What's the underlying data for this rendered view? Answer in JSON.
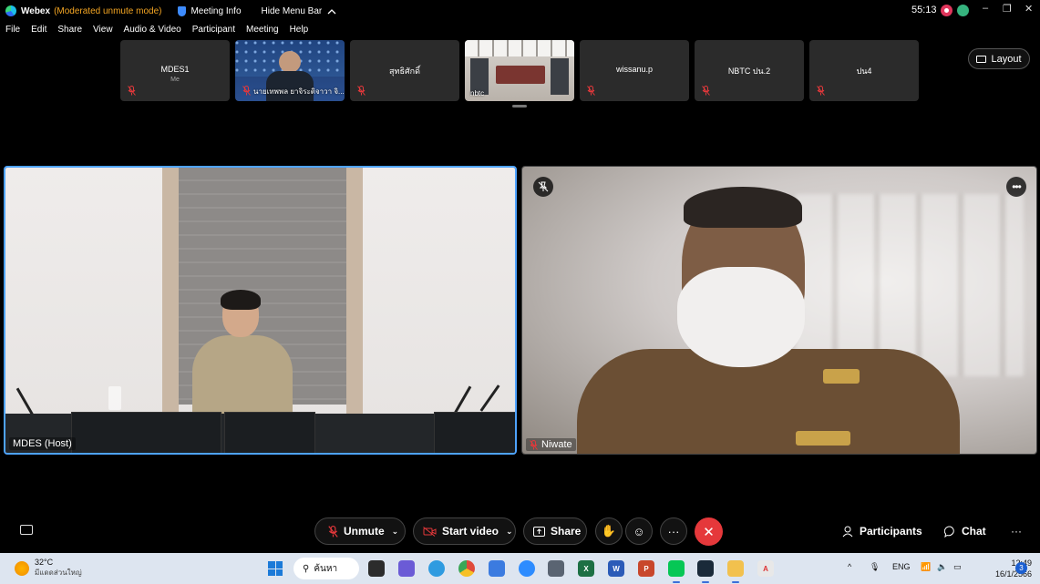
{
  "titlebar": {
    "app_name": "Webex",
    "mode": "(Moderated unmute mode)",
    "meeting_info": "Meeting Info",
    "hide_menu": "Hide Menu Bar",
    "hide_menu_icon": "chevron-up-icon",
    "timer": "55:13",
    "window_controls": [
      "–",
      "❐",
      "✕"
    ]
  },
  "menu": [
    "File",
    "Edit",
    "Share",
    "View",
    "Audio & Video",
    "Participant",
    "Meeting",
    "Help"
  ],
  "thumbnails": [
    {
      "name": "MDES1",
      "sub": "Me",
      "type": "placeholder",
      "muted": true
    },
    {
      "name": "นายเทพพล ยาจิระติจาวา จิ...",
      "sub": "",
      "type": "video",
      "muted": true
    },
    {
      "name": "สุทธิศักดิ์",
      "sub": "",
      "type": "placeholder",
      "muted": true
    },
    {
      "name": "nbtc",
      "sub": "",
      "type": "video",
      "muted": false
    },
    {
      "name": "wissanu.p",
      "sub": "",
      "type": "placeholder",
      "muted": true
    },
    {
      "name": "NBTC ปน.2",
      "sub": "",
      "type": "placeholder",
      "muted": true
    },
    {
      "name": "ปน4",
      "sub": "",
      "type": "placeholder",
      "muted": true
    }
  ],
  "layout_button": "Layout",
  "main_videos": [
    {
      "name": "MDES (Host)",
      "active_speaker": true,
      "muted": false
    },
    {
      "name": "Niwate",
      "active_speaker": false,
      "muted": true
    }
  ],
  "controls": {
    "unmute": "Unmute",
    "start_video": "Start video",
    "share": "Share",
    "participants": "Participants",
    "chat": "Chat",
    "more": "···",
    "end": "✕"
  },
  "colors": {
    "accent_border": "#4ea3ff",
    "mode_text": "#f5a623",
    "end_button": "#e5383b",
    "mute_red": "#e5383b"
  },
  "taskbar": {
    "temperature": "32°C",
    "weather_desc": "มีแดดส่วนใหญ่",
    "search": "ค้นหา",
    "apps": [
      "file-explorer-icon",
      "teams-icon",
      "edge-icon",
      "chrome-icon",
      "photos-icon",
      "zoom-icon",
      "calculator-icon",
      "excel-icon",
      "word-icon",
      "powerpoint-icon",
      "line-icon",
      "webex-icon",
      "folder-icon",
      "pdf-icon"
    ],
    "lang": "ENG",
    "time": "12:49",
    "date": "16/1/2566",
    "notifications": "3"
  }
}
